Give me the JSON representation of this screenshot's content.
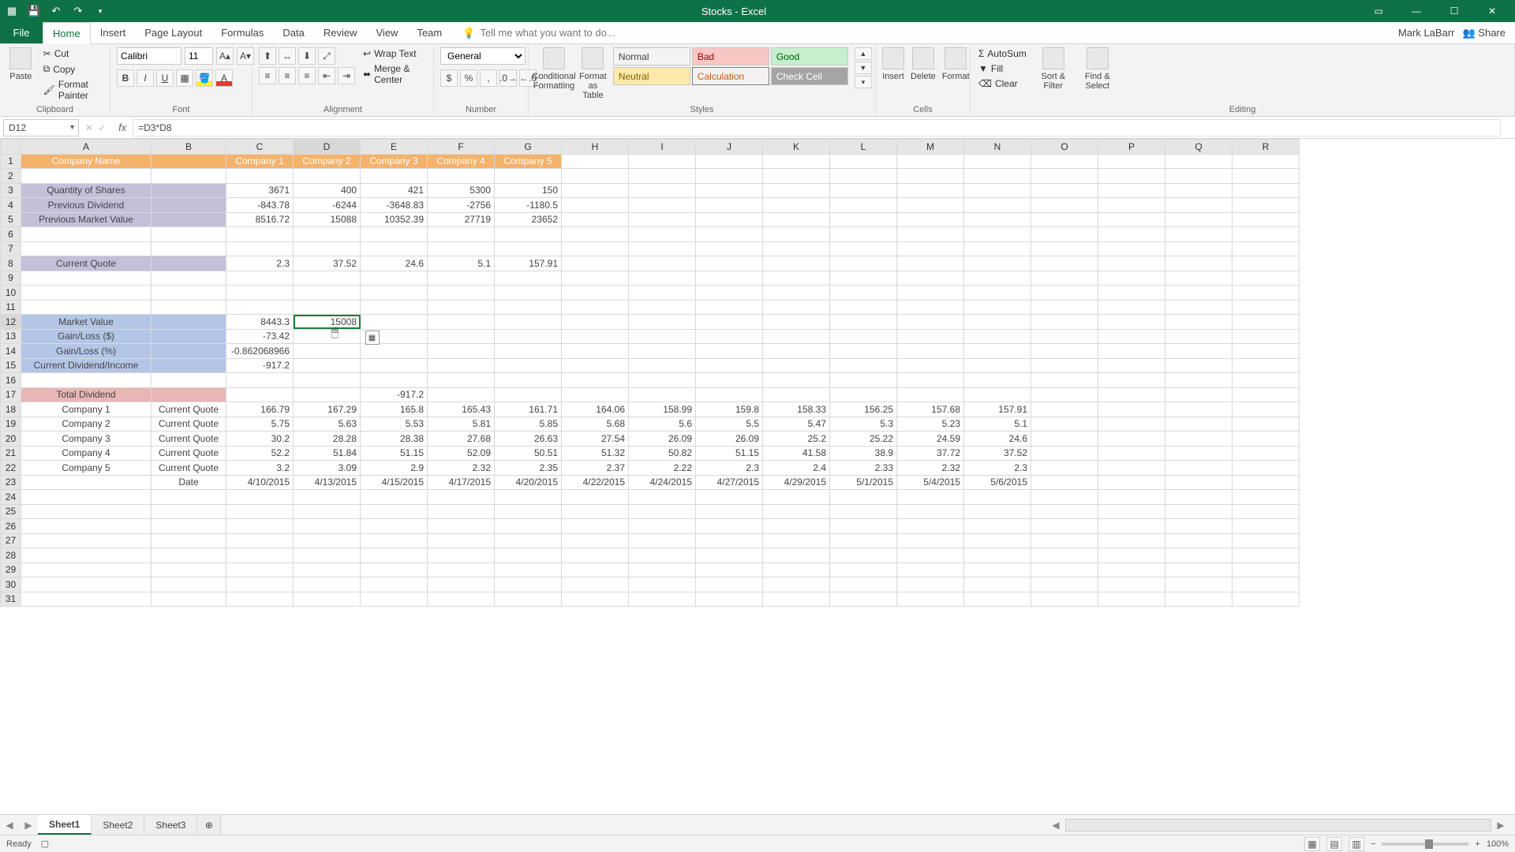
{
  "app": {
    "title": "Stocks - Excel",
    "user": "Mark LaBarr",
    "share": "Share"
  },
  "tabs": {
    "file": "File",
    "home": "Home",
    "insert": "Insert",
    "pageLayout": "Page Layout",
    "formulas": "Formulas",
    "data": "Data",
    "review": "Review",
    "view": "View",
    "team": "Team",
    "tellme": "Tell me what you want to do..."
  },
  "ribbon": {
    "clipboard": {
      "label": "Clipboard",
      "cut": "Cut",
      "copy": "Copy",
      "fp": "Format Painter",
      "paste": "Paste"
    },
    "font": {
      "label": "Font",
      "name": "Calibri",
      "size": "11"
    },
    "alignment": {
      "label": "Alignment",
      "wrap": "Wrap Text",
      "merge": "Merge & Center"
    },
    "number": {
      "label": "Number",
      "format": "General"
    },
    "styles": {
      "label": "Styles",
      "cf": "Conditional Formatting",
      "fat": "Format as Table",
      "normal": "Normal",
      "bad": "Bad",
      "good": "Good",
      "neutral": "Neutral",
      "calc": "Calculation",
      "check": "Check Cell"
    },
    "cells": {
      "label": "Cells",
      "insert": "Insert",
      "delete": "Delete",
      "format": "Format"
    },
    "editing": {
      "label": "Editing",
      "autosum": "AutoSum",
      "fill": "Fill",
      "clear": "Clear",
      "sort": "Sort & Filter",
      "find": "Find & Select"
    }
  },
  "namebox": "D12",
  "formula": "=D3*D8",
  "columns": [
    "A",
    "B",
    "C",
    "D",
    "E",
    "F",
    "G",
    "H",
    "I",
    "J",
    "K",
    "L",
    "M",
    "N",
    "O",
    "P",
    "Q",
    "R"
  ],
  "rows": 31,
  "selectedCol": "D",
  "selectedRow": 12,
  "a": {
    "r1": "Company Name",
    "r3": "Quantity of Shares",
    "r4": "Previous Dividend",
    "r5": "Previous Market Value",
    "r8": "Current Quote",
    "r12": "Market Value",
    "r13": "Gain/Loss ($)",
    "r14": "Gain/Loss (%)",
    "r15": "Current Dividend/Income",
    "r17": "Total Dividend",
    "r18": "Company 1",
    "r19": "Company 2",
    "r20": "Company 3",
    "r21": "Company 4",
    "r22": "Company 5"
  },
  "b": {
    "r18": "Current Quote",
    "r19": "Current Quote",
    "r20": "Current Quote",
    "r21": "Current Quote",
    "r22": "Current Quote",
    "r23": "Date"
  },
  "hdr": {
    "c": "Company 1",
    "d": "Company 2",
    "e": "Company 3",
    "f": "Company 4",
    "g": "Company 5"
  },
  "cells": {
    "r3": {
      "c": "3671",
      "d": "400",
      "e": "421",
      "f": "5300",
      "g": "150"
    },
    "r4": {
      "c": "-843.78",
      "d": "-6244",
      "e": "-3648.83",
      "f": "-2756",
      "g": "-1180.5"
    },
    "r5": {
      "c": "8516.72",
      "d": "15088",
      "e": "10352.39",
      "f": "27719",
      "g": "23652"
    },
    "r8": {
      "c": "2.3",
      "d": "37.52",
      "e": "24.6",
      "f": "5.1",
      "g": "157.91"
    },
    "r12": {
      "c": "8443.3",
      "d": "15008"
    },
    "r13": {
      "c": "-73.42"
    },
    "r14": {
      "c": "-0.862068966"
    },
    "r15": {
      "c": "-917.2"
    },
    "r17": {
      "e": "-917.2"
    },
    "r18": {
      "c": "166.79",
      "d": "167.29",
      "e": "165.8",
      "f": "165.43",
      "g": "161.71",
      "h": "164.06",
      "i": "158.99",
      "j": "159.8",
      "k": "158.33",
      "l": "156.25",
      "m": "157.68",
      "n": "157.91"
    },
    "r19": {
      "c": "5.75",
      "d": "5.63",
      "e": "5.53",
      "f": "5.81",
      "g": "5.85",
      "h": "5.68",
      "i": "5.6",
      "j": "5.5",
      "k": "5.47",
      "l": "5.3",
      "m": "5.23",
      "n": "5.1"
    },
    "r20": {
      "c": "30.2",
      "d": "28.28",
      "e": "28.38",
      "f": "27.68",
      "g": "26.63",
      "h": "27.54",
      "i": "26.09",
      "j": "26.09",
      "k": "25.2",
      "l": "25.22",
      "m": "24.59",
      "n": "24.6"
    },
    "r21": {
      "c": "52.2",
      "d": "51.84",
      "e": "51.15",
      "f": "52.09",
      "g": "50.51",
      "h": "51.32",
      "i": "50.82",
      "j": "51.15",
      "k": "41.58",
      "l": "38.9",
      "m": "37.72",
      "n": "37.52"
    },
    "r22": {
      "c": "3.2",
      "d": "3.09",
      "e": "2.9",
      "f": "2.32",
      "g": "2.35",
      "h": "2.37",
      "i": "2.22",
      "j": "2.3",
      "k": "2.4",
      "l": "2.33",
      "m": "2.32",
      "n": "2.3"
    },
    "r23": {
      "c": "4/10/2015",
      "d": "4/13/2015",
      "e": "4/15/2015",
      "f": "4/17/2015",
      "g": "4/20/2015",
      "h": "4/22/2015",
      "i": "4/24/2015",
      "j": "4/27/2015",
      "k": "4/29/2015",
      "l": "5/1/2015",
      "m": "5/4/2015",
      "n": "5/6/2015"
    }
  },
  "sheets": {
    "s1": "Sheet1",
    "s2": "Sheet2",
    "s3": "Sheet3"
  },
  "status": {
    "ready": "Ready",
    "zoom": "100%"
  }
}
